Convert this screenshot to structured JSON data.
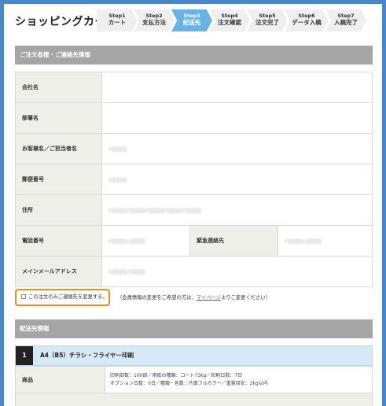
{
  "header": {
    "title": "ショッピングカート",
    "steps": [
      {
        "num": "Step1",
        "label": "カート"
      },
      {
        "num": "Step2",
        "label": "支払方法"
      },
      {
        "num": "Step3",
        "label": "配送先"
      },
      {
        "num": "Step4",
        "label": "注文確認"
      },
      {
        "num": "Step5",
        "label": "注文完了"
      },
      {
        "num": "Step6",
        "label": "データ入稿"
      },
      {
        "num": "Step7",
        "label": "入稿完了"
      }
    ],
    "active_step": 3
  },
  "customer_section": {
    "title": "ご注文者様・ご連絡先情報",
    "rows": [
      {
        "label": "会社名",
        "value": ""
      },
      {
        "label": "部署名",
        "value": ""
      },
      {
        "label": "お客様名／ご担当者名",
        "value": "ｲﾛﾛﾛﾛ"
      },
      {
        "label": "郵便番号",
        "value": "ｲﾛﾛﾛﾛ"
      },
      {
        "label": "住所",
        "value": "ｲﾛﾛﾛﾛｲﾛﾛﾛﾛｲﾛﾛﾛﾛｲﾛﾛﾛﾛｲﾛﾛﾛﾛ"
      },
      {
        "label": "電話番号",
        "value": "ｲﾛﾛﾛﾛｲﾛﾛﾛﾛ"
      },
      {
        "label": "メインメールアドレス",
        "value": "ｲﾛﾛﾛﾛｲﾛﾛﾛﾛ"
      }
    ],
    "emergency_label": "緊急連絡先",
    "emergency_value": "ｲﾛﾛﾛﾛｲﾛﾛﾛﾛ"
  },
  "change_contact": {
    "checkbox_label": "この注文のみご連絡先を変更する。",
    "note_before": "（会員情報の変更をご希望の方は、",
    "note_link": "マイページ",
    "note_after": "よりご変更ください）"
  },
  "shipping_section": {
    "title": "配送先情報",
    "product_number": "1",
    "product_title": "A4（B5）チラシ・フライヤー印刷",
    "product_label": "商品",
    "product_detail_1": "印刷部数：100部／用紙の種類：コート73kg／印刷日数：7日",
    "product_detail_2": "オプション日数：0日／種類・色数：片面フルカラー／重量目安：2kg以内"
  },
  "colors": {
    "background": "#4a86c8",
    "active_step": "#6ab3e6",
    "section_header": "#a5a5a5",
    "highlight_border": "#e8901f",
    "link": "#3a66b6"
  }
}
